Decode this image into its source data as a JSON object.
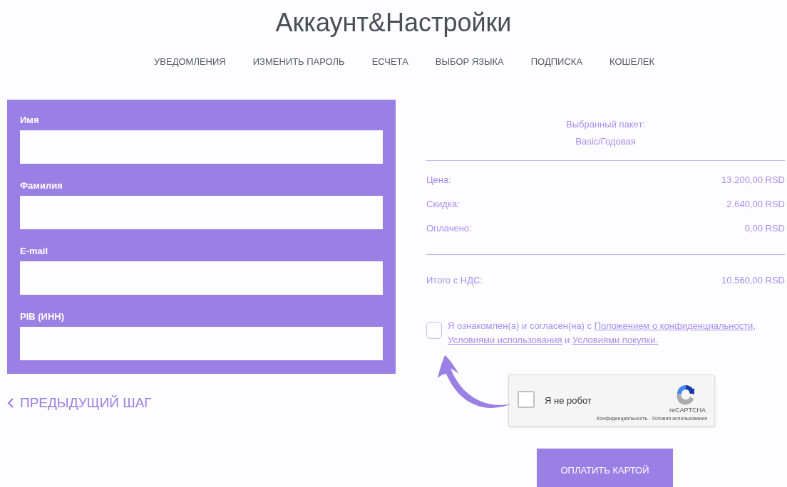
{
  "title": "Аккаунт&Настройки",
  "nav": [
    "УВЕДОМЛЕНИЯ",
    "ИЗМЕНИТЬ ПАРОЛЬ",
    "ЕСЧЕТА",
    "ВЫБОР ЯЗЫКА",
    "ПОДПИСКА",
    "КОШЕЛЕК"
  ],
  "form": {
    "fields": [
      {
        "label": "Имя"
      },
      {
        "label": "Фамилия"
      },
      {
        "label": "E-mail"
      },
      {
        "label": "PIB (ИНН)"
      }
    ]
  },
  "back_link": "ПРЕДЫДУЩИЙ ШАГ",
  "summary": {
    "package_label": "Выбранный пакет:",
    "package": "Basic/Годовая",
    "rows": [
      {
        "label": "Цена:",
        "value": "13.200,00 RSD"
      },
      {
        "label": "Скидка:",
        "value": "2.640,00 RSD"
      },
      {
        "label": "Оплачено:",
        "value": "0,00 RSD"
      }
    ],
    "total": {
      "label": "Итого с НДС:",
      "value": "10.560,00 RSD"
    }
  },
  "agreement": {
    "checked": false,
    "segments": [
      {
        "kind": "text",
        "text": "Я ознакомлен(а) и согласен(на) с "
      },
      {
        "kind": "link",
        "text": "Положением о конфиденциальности"
      },
      {
        "kind": "text",
        "text": ", "
      },
      {
        "kind": "link",
        "text": "Условиями использования"
      },
      {
        "kind": "text",
        "text": " и "
      },
      {
        "kind": "link",
        "text": "Условиями покупки."
      }
    ]
  },
  "captcha": {
    "checked": false,
    "label": "Я не робот",
    "brand": "reCAPTCHA",
    "links": "Конфиденциальность - Условия использования"
  },
  "pay_button": "ОПЛАТИТЬ КАРТОЙ"
}
